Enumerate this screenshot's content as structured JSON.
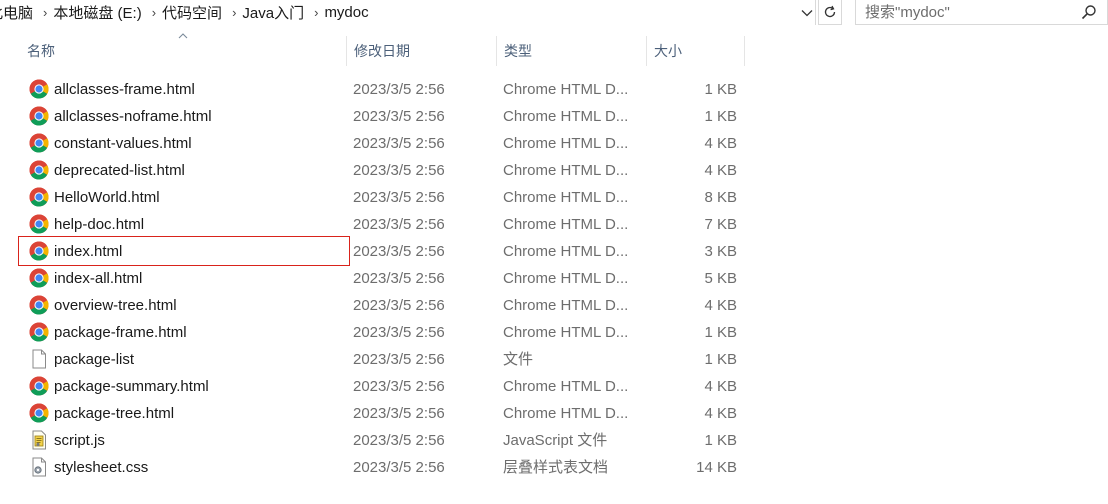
{
  "breadcrumb": {
    "items": [
      "此电脑",
      "本地磁盘 (E:)",
      "代码空间",
      "Java入门",
      "mydoc"
    ]
  },
  "search": {
    "placeholder": "搜索\"mydoc\""
  },
  "columns": {
    "name": "名称",
    "date": "修改日期",
    "type": "类型",
    "size": "大小"
  },
  "files": [
    {
      "name": "allclasses-frame.html",
      "date": "2023/3/5 2:56",
      "type": "Chrome HTML D...",
      "size": "1 KB",
      "icon": "chrome-icon"
    },
    {
      "name": "allclasses-noframe.html",
      "date": "2023/3/5 2:56",
      "type": "Chrome HTML D...",
      "size": "1 KB",
      "icon": "chrome-icon"
    },
    {
      "name": "constant-values.html",
      "date": "2023/3/5 2:56",
      "type": "Chrome HTML D...",
      "size": "4 KB",
      "icon": "chrome-icon"
    },
    {
      "name": "deprecated-list.html",
      "date": "2023/3/5 2:56",
      "type": "Chrome HTML D...",
      "size": "4 KB",
      "icon": "chrome-icon"
    },
    {
      "name": "HelloWorld.html",
      "date": "2023/3/5 2:56",
      "type": "Chrome HTML D...",
      "size": "8 KB",
      "icon": "chrome-icon"
    },
    {
      "name": "help-doc.html",
      "date": "2023/3/5 2:56",
      "type": "Chrome HTML D...",
      "size": "7 KB",
      "icon": "chrome-icon"
    },
    {
      "name": "index.html",
      "date": "2023/3/5 2:56",
      "type": "Chrome HTML D...",
      "size": "3 KB",
      "icon": "chrome-icon"
    },
    {
      "name": "index-all.html",
      "date": "2023/3/5 2:56",
      "type": "Chrome HTML D...",
      "size": "5 KB",
      "icon": "chrome-icon"
    },
    {
      "name": "overview-tree.html",
      "date": "2023/3/5 2:56",
      "type": "Chrome HTML D...",
      "size": "4 KB",
      "icon": "chrome-icon"
    },
    {
      "name": "package-frame.html",
      "date": "2023/3/5 2:56",
      "type": "Chrome HTML D...",
      "size": "1 KB",
      "icon": "chrome-icon"
    },
    {
      "name": "package-list",
      "date": "2023/3/5 2:56",
      "type": "文件",
      "size": "1 KB",
      "icon": "blank-file-icon"
    },
    {
      "name": "package-summary.html",
      "date": "2023/3/5 2:56",
      "type": "Chrome HTML D...",
      "size": "4 KB",
      "icon": "chrome-icon"
    },
    {
      "name": "package-tree.html",
      "date": "2023/3/5 2:56",
      "type": "Chrome HTML D...",
      "size": "4 KB",
      "icon": "chrome-icon"
    },
    {
      "name": "script.js",
      "date": "2023/3/5 2:56",
      "type": "JavaScript 文件",
      "size": "1 KB",
      "icon": "script-file-icon"
    },
    {
      "name": "stylesheet.css",
      "date": "2023/3/5 2:56",
      "type": "层叠样式表文档",
      "size": "14 KB",
      "icon": "css-file-icon"
    }
  ],
  "highlighted_file": "index.html",
  "colors": {
    "highlight_outline": "#d9231b",
    "header_text": "#4c607a",
    "secondary_text": "#6d6d6d"
  }
}
